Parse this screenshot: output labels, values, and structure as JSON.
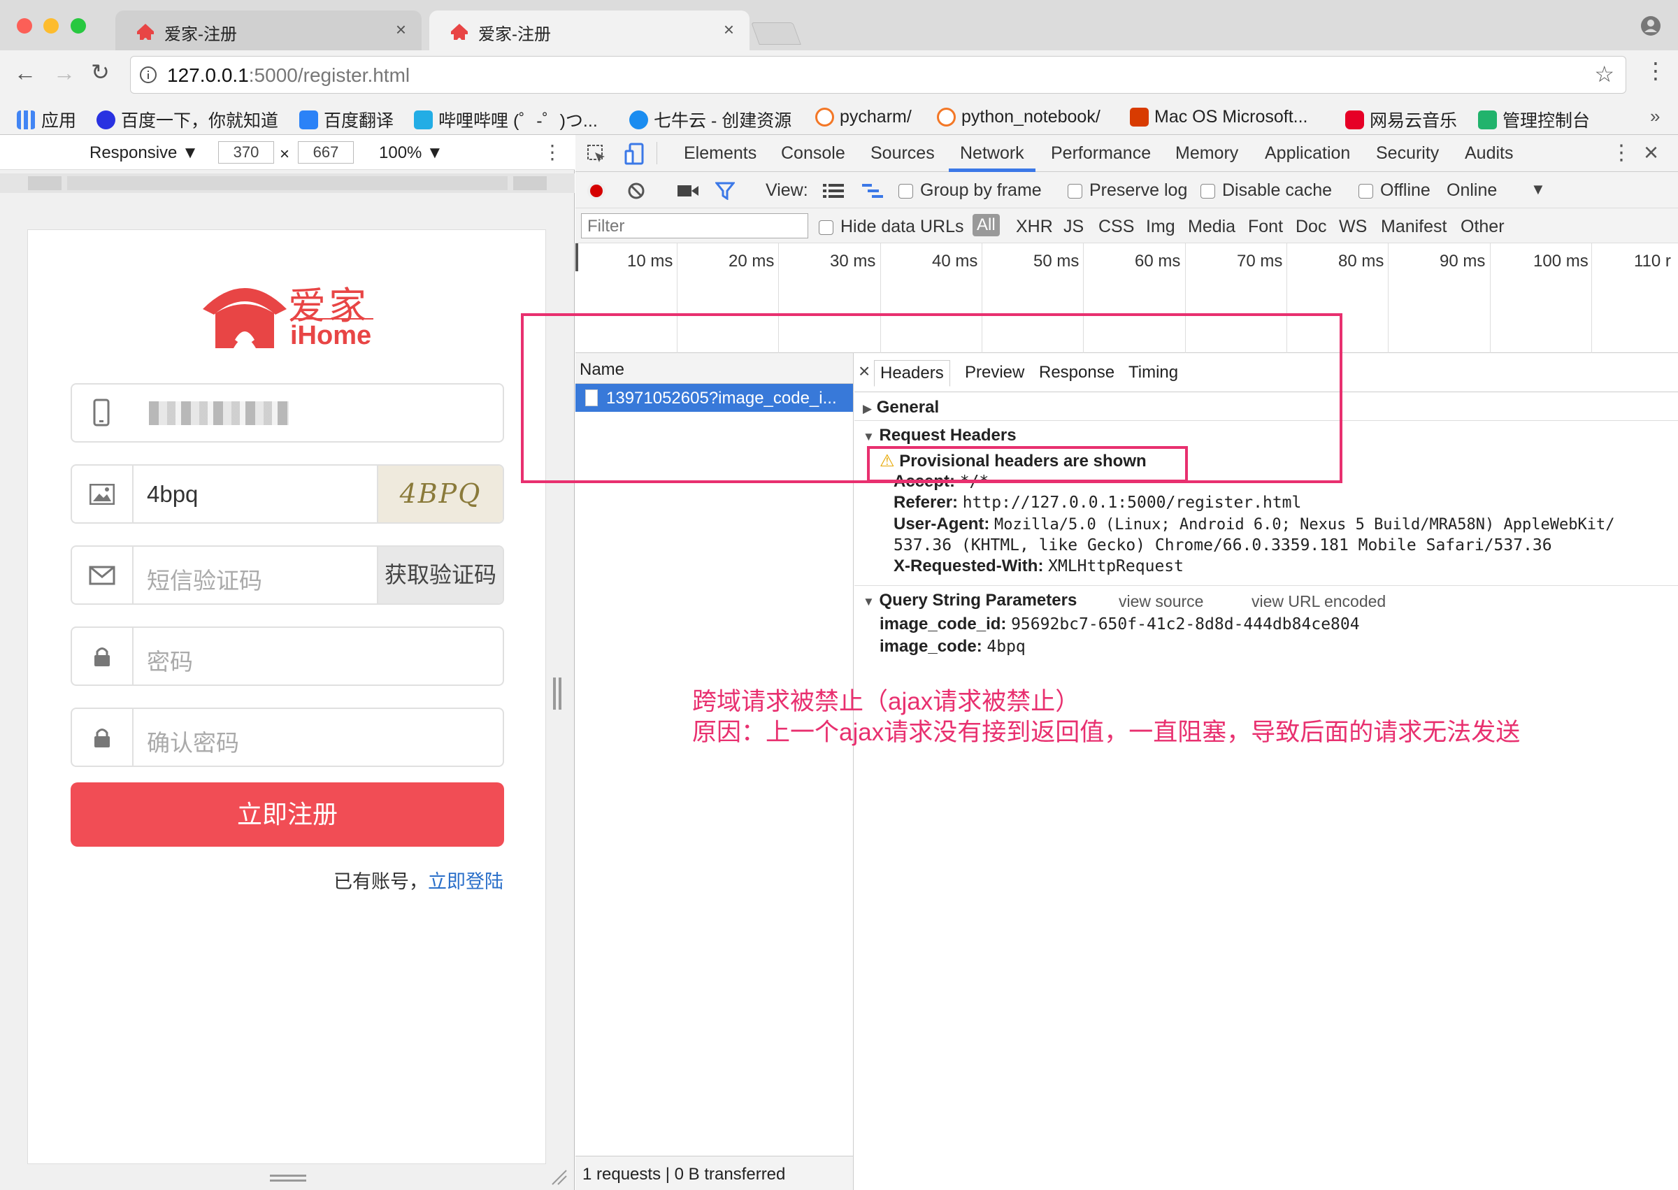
{
  "tabs": [
    {
      "title": "爱家-注册"
    },
    {
      "title": "爱家-注册"
    }
  ],
  "address": {
    "host": "127.0.0.1",
    "rest": ":5000/register.html"
  },
  "bookmarks": [
    {
      "label": "应用",
      "icon": "apps-grid-icon",
      "color": "#4285f4"
    },
    {
      "label": "百度一下，你就知道",
      "icon": "baidu-paw-icon",
      "color": "#2932e1"
    },
    {
      "label": "百度翻译",
      "icon": "translate-icon",
      "color": "#2b82f7"
    },
    {
      "label": "哔哩哔哩 (゜-゜)つ...",
      "icon": "bilibili-icon",
      "color": "#23ade5"
    },
    {
      "label": "七牛云 - 创建资源",
      "icon": "qiniu-icon",
      "color": "#1a8cf0"
    },
    {
      "label": "pycharm/",
      "icon": "jupyter-icon",
      "color": "#f37726"
    },
    {
      "label": "python_notebook/",
      "icon": "jupyter-icon",
      "color": "#f37726"
    },
    {
      "label": "Mac OS Microsoft...",
      "icon": "office-icon",
      "color": "#d83b01"
    },
    {
      "label": "网易云音乐",
      "icon": "netease-music-icon",
      "color": "#e60026"
    },
    {
      "label": "管理控制台",
      "icon": "console-icon",
      "color": "#21b36c"
    }
  ],
  "device": {
    "mode": "Responsive ▼",
    "width": "370",
    "x": "×",
    "height": "667",
    "zoom": "100% ▼"
  },
  "app": {
    "logo_cn": "爱家",
    "logo_en": "iHome",
    "phone_value": "",
    "captcha_value": "4bpq",
    "captcha_image_text": "4BPQ",
    "sms_placeholder": "短信验证码",
    "sms_button": "获取验证码",
    "password_placeholder": "密码",
    "confirm_placeholder": "确认密码",
    "register_button": "立即注册",
    "login_prompt": "已有账号，",
    "login_link": "立即登陆"
  },
  "devtools": {
    "tabs": [
      "Elements",
      "Console",
      "Sources",
      "Network",
      "Performance",
      "Memory",
      "Application",
      "Security",
      "Audits"
    ],
    "active_tab": "Network",
    "toolbar": {
      "view": "View:",
      "group_by_frame": "Group by frame",
      "preserve_log": "Preserve log",
      "disable_cache": "Disable cache",
      "offline": "Offline",
      "online": "Online"
    },
    "filter": {
      "placeholder": "Filter",
      "hide_data_urls": "Hide data URLs",
      "types": [
        "All",
        "XHR",
        "JS",
        "CSS",
        "Img",
        "Media",
        "Font",
        "Doc",
        "WS",
        "Manifest",
        "Other"
      ]
    },
    "timeline_ticks": [
      "10 ms",
      "20 ms",
      "30 ms",
      "40 ms",
      "50 ms",
      "60 ms",
      "70 ms",
      "80 ms",
      "90 ms",
      "100 ms",
      "110 r"
    ],
    "name_header": "Name",
    "request_name": "13971052605?image_code_i...",
    "status": "1 requests | 0 B transferred",
    "detail_tabs": [
      "Headers",
      "Preview",
      "Response",
      "Timing"
    ],
    "general": "General",
    "request_headers": "Request Headers",
    "provisional": "Provisional headers are shown",
    "headers": [
      {
        "k": "Accept:",
        "v": "*/*"
      },
      {
        "k": "Referer:",
        "v": "http://127.0.0.1:5000/register.html"
      },
      {
        "k": "User-Agent:",
        "v": "Mozilla/5.0 (Linux; Android 6.0; Nexus 5 Build/MRA58N) AppleWebKit/"
      },
      {
        "k": "",
        "v": "537.36 (KHTML, like Gecko) Chrome/66.0.3359.181 Mobile Safari/537.36"
      },
      {
        "k": "X-Requested-With:",
        "v": "XMLHttpRequest"
      }
    ],
    "qsp": {
      "title": "Query String Parameters",
      "view_source": "view source",
      "view_url_encoded": "view URL encoded",
      "params": [
        {
          "k": "image_code_id:",
          "v": "95692bc7-650f-41c2-8d8d-444db84ce804"
        },
        {
          "k": "image_code:",
          "v": "4bpq"
        }
      ]
    }
  },
  "annotation": {
    "line1": "跨域请求被禁止（ajax请求被禁止）",
    "line2": "原因：上一个ajax请求没有接到返回值，一直阻塞，导致后面的请求无法发送"
  }
}
